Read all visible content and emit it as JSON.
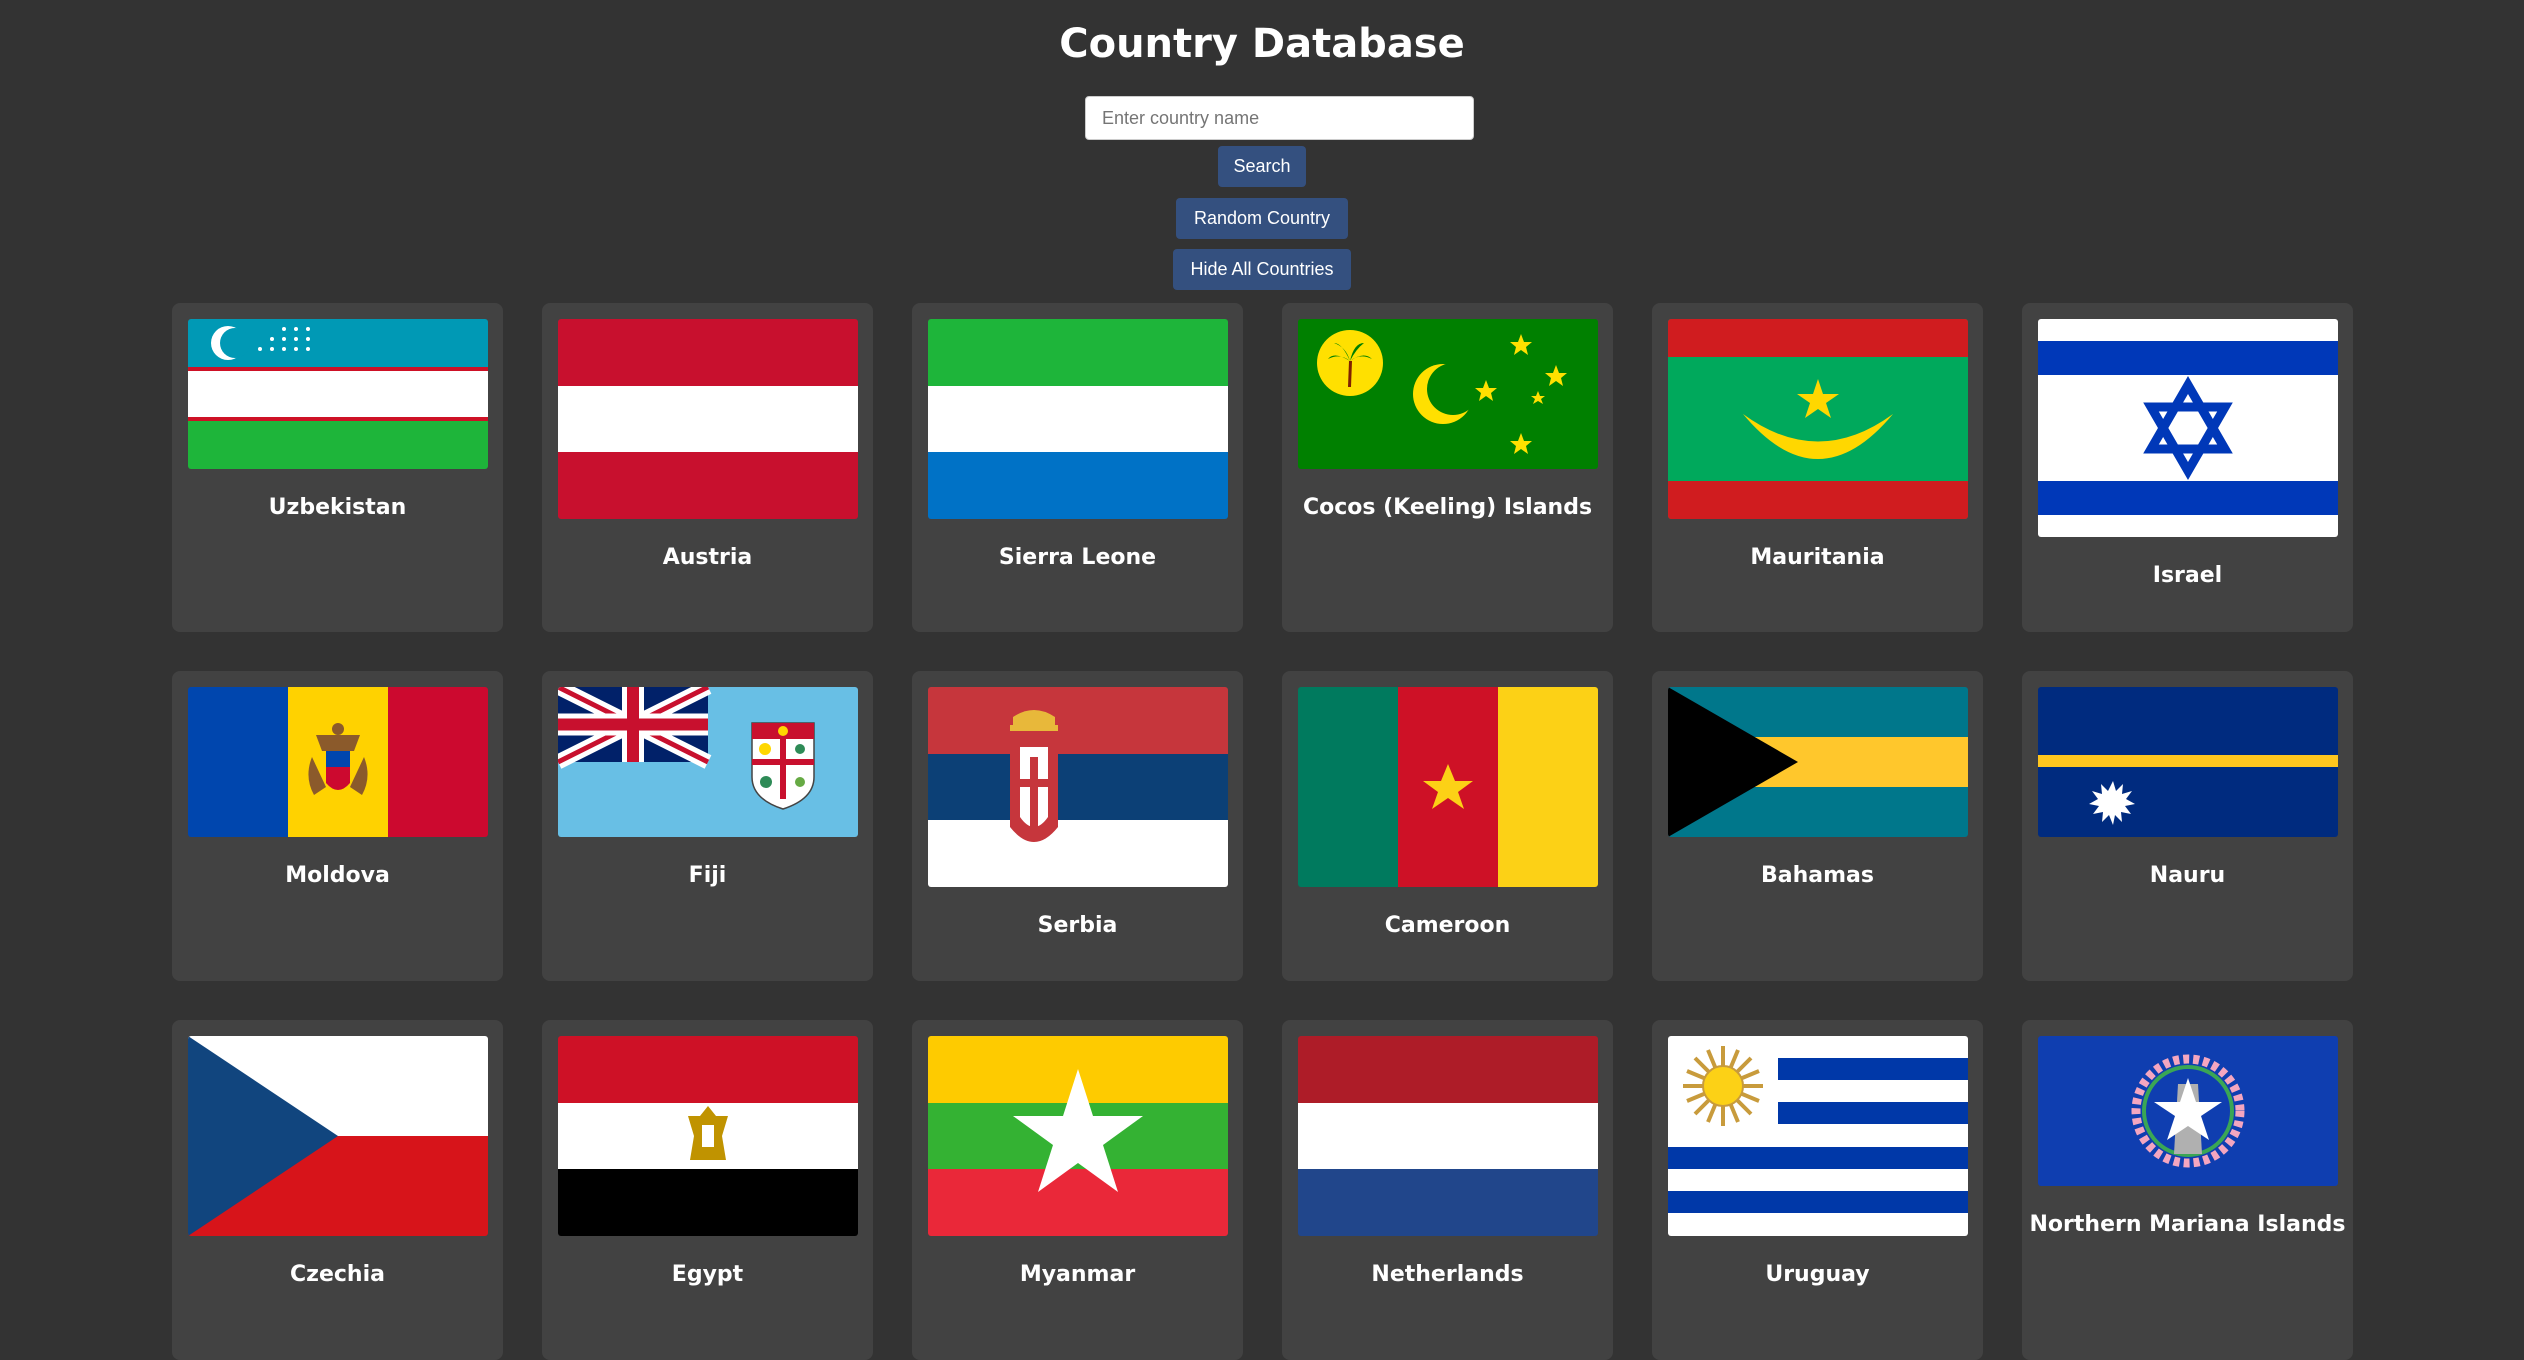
{
  "header": {
    "title": "Country Database"
  },
  "search": {
    "placeholder": "Enter country name",
    "value": ""
  },
  "buttons": {
    "search": "Search",
    "random": "Random Country",
    "hide": "Hide All Countries"
  },
  "countries": [
    {
      "name": "Uzbekistan",
      "flag_icon": "uzbekistan-flag-icon"
    },
    {
      "name": "Austria",
      "flag_icon": "austria-flag-icon"
    },
    {
      "name": "Sierra Leone",
      "flag_icon": "sierra-leone-flag-icon"
    },
    {
      "name": "Cocos (Keeling) Islands",
      "flag_icon": "cocos-keeling-islands-flag-icon"
    },
    {
      "name": "Mauritania",
      "flag_icon": "mauritania-flag-icon"
    },
    {
      "name": "Israel",
      "flag_icon": "israel-flag-icon"
    },
    {
      "name": "Moldova",
      "flag_icon": "moldova-flag-icon"
    },
    {
      "name": "Fiji",
      "flag_icon": "fiji-flag-icon"
    },
    {
      "name": "Serbia",
      "flag_icon": "serbia-flag-icon"
    },
    {
      "name": "Cameroon",
      "flag_icon": "cameroon-flag-icon"
    },
    {
      "name": "Bahamas",
      "flag_icon": "bahamas-flag-icon"
    },
    {
      "name": "Nauru",
      "flag_icon": "nauru-flag-icon"
    },
    {
      "name": "Czechia",
      "flag_icon": "czechia-flag-icon"
    },
    {
      "name": "Egypt",
      "flag_icon": "egypt-flag-icon"
    },
    {
      "name": "Myanmar",
      "flag_icon": "myanmar-flag-icon"
    },
    {
      "name": "Netherlands",
      "flag_icon": "netherlands-flag-icon"
    },
    {
      "name": "Uruguay",
      "flag_icon": "uruguay-flag-icon"
    },
    {
      "name": "Northern Mariana Islands",
      "flag_icon": "northern-mariana-islands-flag-icon"
    }
  ],
  "colors": {
    "background": "#333333",
    "card": "#424242",
    "button": "#34507f",
    "text": "#ffffff"
  }
}
